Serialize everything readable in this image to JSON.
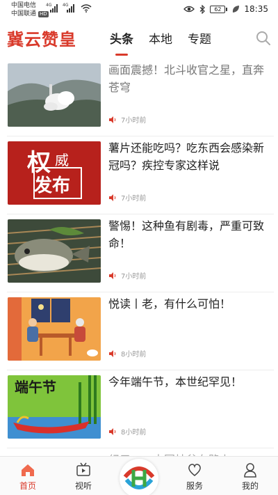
{
  "status_bar": {
    "carrier_1": "中国电信",
    "carrier_2": "中国联通",
    "hd_badge": "HD",
    "net_1": "4G",
    "net_2": "4G",
    "battery": "62",
    "time": "18:35"
  },
  "header": {
    "brand": "冀云赞皇",
    "tabs": [
      {
        "label": "头条",
        "active": true
      },
      {
        "label": "本地",
        "active": false
      },
      {
        "label": "专题",
        "active": false
      }
    ],
    "search_icon": "search-icon"
  },
  "news": [
    {
      "title": "画面震撼！北斗收官之星，直奔苍穹",
      "time": "7小时前",
      "read": true
    },
    {
      "title": "薯片还能吃吗？吃东西会感染新冠吗？疾控专家这样说",
      "time": "7小时前",
      "read": false
    },
    {
      "title": "警惕！这种鱼有剧毒，严重可致命！",
      "time": "7小时前",
      "read": false
    },
    {
      "title": "悦读丨老，有什么可怕！",
      "time": "8小时前",
      "read": false
    },
    {
      "title": "今年端午节，本世纪罕见！",
      "time": "8小时前",
      "read": false
    }
  ],
  "thumb_text": {
    "authority_1": "权",
    "authority_2": "威",
    "authority_3": "发布",
    "dragon_boat": "端午节"
  },
  "partial_title": "纪元……中国扶贫在路上",
  "bottom_nav": [
    {
      "label": "首页",
      "icon": "home-icon",
      "active": true
    },
    {
      "label": "视听",
      "icon": "tv-icon",
      "active": false
    },
    {
      "label": "",
      "icon": "logo-icon",
      "active": false
    },
    {
      "label": "服务",
      "icon": "heart-icon",
      "active": false
    },
    {
      "label": "我的",
      "icon": "person-icon",
      "active": false
    }
  ],
  "colors": {
    "brand_red": "#d93a2b",
    "meta_gray": "#999999"
  }
}
